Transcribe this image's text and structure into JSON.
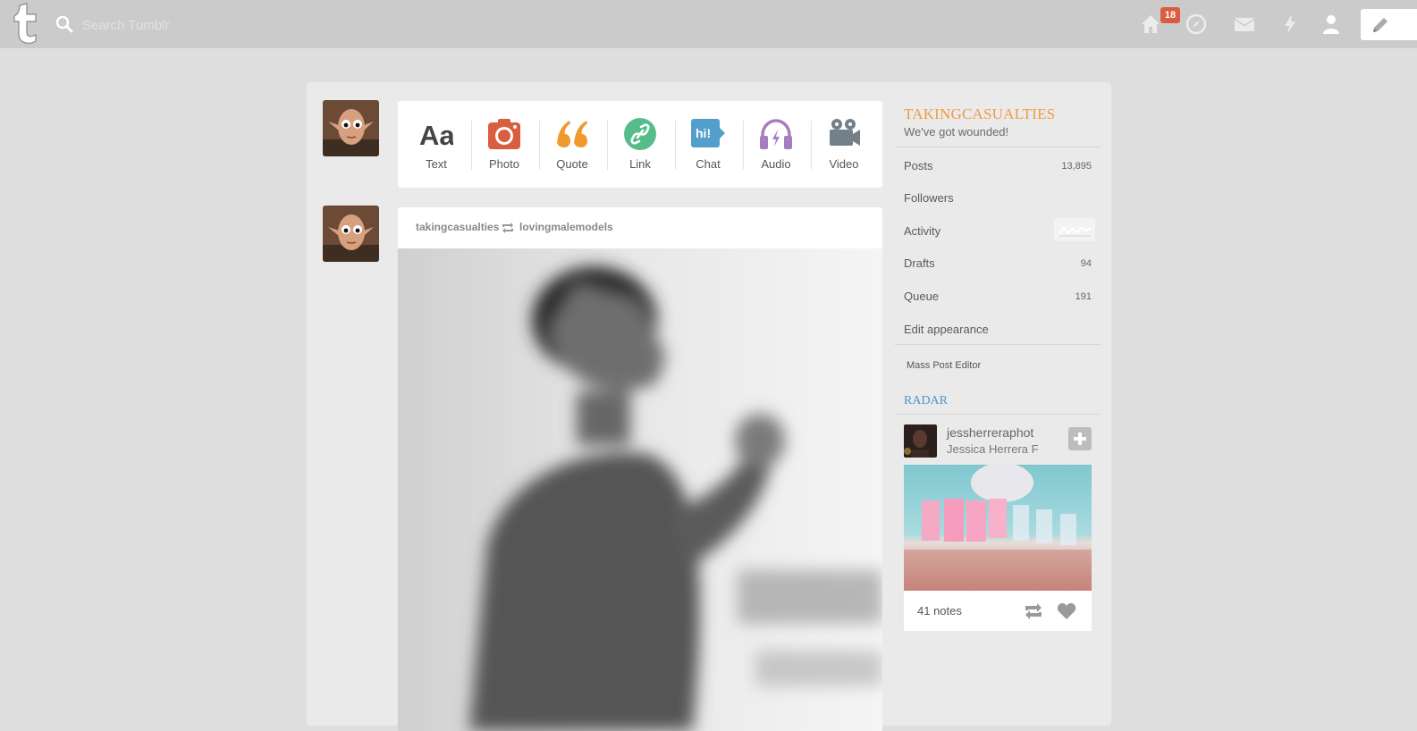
{
  "topbar": {
    "search_placeholder": "Search Tumblr",
    "notification_count": "18",
    "icons": [
      "tumblr-logo-icon",
      "search-icon",
      "home-icon",
      "explore-icon",
      "mail-icon",
      "activity-icon",
      "account-icon",
      "compose-icon"
    ]
  },
  "post_types": [
    {
      "label": "Text",
      "icon": "text-icon",
      "color": "#444444"
    },
    {
      "label": "Photo",
      "icon": "camera-icon",
      "color": "#d95e40"
    },
    {
      "label": "Quote",
      "icon": "quote-icon",
      "color": "#f2992e"
    },
    {
      "label": "Link",
      "icon": "link-icon",
      "color": "#56bc8a"
    },
    {
      "label": "Chat",
      "icon": "chat-icon",
      "color": "#529ecc"
    },
    {
      "label": "Audio",
      "icon": "audio-icon",
      "color": "#a77dc2"
    },
    {
      "label": "Video",
      "icon": "video-icon",
      "color": "#748089"
    }
  ],
  "post": {
    "author": "takingcasualties",
    "source": "lovingmalemodels"
  },
  "sidebar": {
    "blog_title": "TAKINGCASUALTIES",
    "blog_subtitle": "We've got wounded!",
    "items": [
      {
        "label": "Posts",
        "count": "13,895"
      },
      {
        "label": "Followers",
        "count": ""
      },
      {
        "label": "Activity",
        "count": ""
      },
      {
        "label": "Drafts",
        "count": "94"
      },
      {
        "label": "Queue",
        "count": "191"
      },
      {
        "label": "Edit appearance",
        "count": ""
      }
    ],
    "mass_post_editor": "Mass Post Editor",
    "radar": {
      "heading": "RADAR",
      "username": "jessherreraphot",
      "name": "Jessica Herrera F",
      "notes": "41 notes"
    }
  },
  "colors": {
    "topbar": "#cbcbcb",
    "background": "#dedede",
    "title_orange": "#f29a3f",
    "radar_blue": "#4f94c7",
    "badge_red": "#d95e40"
  }
}
